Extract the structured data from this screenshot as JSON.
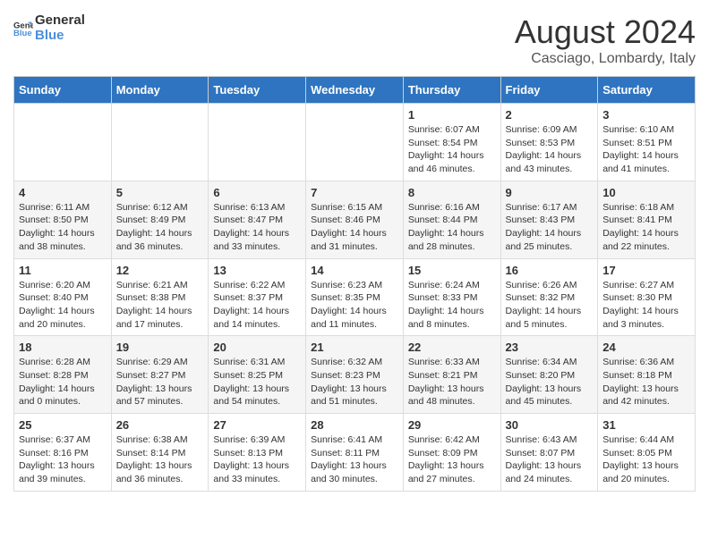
{
  "logo": {
    "line1": "General",
    "line2": "Blue"
  },
  "title": "August 2024",
  "subtitle": "Casciago, Lombardy, Italy",
  "days_of_week": [
    "Sunday",
    "Monday",
    "Tuesday",
    "Wednesday",
    "Thursday",
    "Friday",
    "Saturday"
  ],
  "weeks": [
    [
      {
        "day": "",
        "info": ""
      },
      {
        "day": "",
        "info": ""
      },
      {
        "day": "",
        "info": ""
      },
      {
        "day": "",
        "info": ""
      },
      {
        "day": "1",
        "info": "Sunrise: 6:07 AM\nSunset: 8:54 PM\nDaylight: 14 hours\nand 46 minutes."
      },
      {
        "day": "2",
        "info": "Sunrise: 6:09 AM\nSunset: 8:53 PM\nDaylight: 14 hours\nand 43 minutes."
      },
      {
        "day": "3",
        "info": "Sunrise: 6:10 AM\nSunset: 8:51 PM\nDaylight: 14 hours\nand 41 minutes."
      }
    ],
    [
      {
        "day": "4",
        "info": "Sunrise: 6:11 AM\nSunset: 8:50 PM\nDaylight: 14 hours\nand 38 minutes."
      },
      {
        "day": "5",
        "info": "Sunrise: 6:12 AM\nSunset: 8:49 PM\nDaylight: 14 hours\nand 36 minutes."
      },
      {
        "day": "6",
        "info": "Sunrise: 6:13 AM\nSunset: 8:47 PM\nDaylight: 14 hours\nand 33 minutes."
      },
      {
        "day": "7",
        "info": "Sunrise: 6:15 AM\nSunset: 8:46 PM\nDaylight: 14 hours\nand 31 minutes."
      },
      {
        "day": "8",
        "info": "Sunrise: 6:16 AM\nSunset: 8:44 PM\nDaylight: 14 hours\nand 28 minutes."
      },
      {
        "day": "9",
        "info": "Sunrise: 6:17 AM\nSunset: 8:43 PM\nDaylight: 14 hours\nand 25 minutes."
      },
      {
        "day": "10",
        "info": "Sunrise: 6:18 AM\nSunset: 8:41 PM\nDaylight: 14 hours\nand 22 minutes."
      }
    ],
    [
      {
        "day": "11",
        "info": "Sunrise: 6:20 AM\nSunset: 8:40 PM\nDaylight: 14 hours\nand 20 minutes."
      },
      {
        "day": "12",
        "info": "Sunrise: 6:21 AM\nSunset: 8:38 PM\nDaylight: 14 hours\nand 17 minutes."
      },
      {
        "day": "13",
        "info": "Sunrise: 6:22 AM\nSunset: 8:37 PM\nDaylight: 14 hours\nand 14 minutes."
      },
      {
        "day": "14",
        "info": "Sunrise: 6:23 AM\nSunset: 8:35 PM\nDaylight: 14 hours\nand 11 minutes."
      },
      {
        "day": "15",
        "info": "Sunrise: 6:24 AM\nSunset: 8:33 PM\nDaylight: 14 hours\nand 8 minutes."
      },
      {
        "day": "16",
        "info": "Sunrise: 6:26 AM\nSunset: 8:32 PM\nDaylight: 14 hours\nand 5 minutes."
      },
      {
        "day": "17",
        "info": "Sunrise: 6:27 AM\nSunset: 8:30 PM\nDaylight: 14 hours\nand 3 minutes."
      }
    ],
    [
      {
        "day": "18",
        "info": "Sunrise: 6:28 AM\nSunset: 8:28 PM\nDaylight: 14 hours\nand 0 minutes."
      },
      {
        "day": "19",
        "info": "Sunrise: 6:29 AM\nSunset: 8:27 PM\nDaylight: 13 hours\nand 57 minutes."
      },
      {
        "day": "20",
        "info": "Sunrise: 6:31 AM\nSunset: 8:25 PM\nDaylight: 13 hours\nand 54 minutes."
      },
      {
        "day": "21",
        "info": "Sunrise: 6:32 AM\nSunset: 8:23 PM\nDaylight: 13 hours\nand 51 minutes."
      },
      {
        "day": "22",
        "info": "Sunrise: 6:33 AM\nSunset: 8:21 PM\nDaylight: 13 hours\nand 48 minutes."
      },
      {
        "day": "23",
        "info": "Sunrise: 6:34 AM\nSunset: 8:20 PM\nDaylight: 13 hours\nand 45 minutes."
      },
      {
        "day": "24",
        "info": "Sunrise: 6:36 AM\nSunset: 8:18 PM\nDaylight: 13 hours\nand 42 minutes."
      }
    ],
    [
      {
        "day": "25",
        "info": "Sunrise: 6:37 AM\nSunset: 8:16 PM\nDaylight: 13 hours\nand 39 minutes."
      },
      {
        "day": "26",
        "info": "Sunrise: 6:38 AM\nSunset: 8:14 PM\nDaylight: 13 hours\nand 36 minutes."
      },
      {
        "day": "27",
        "info": "Sunrise: 6:39 AM\nSunset: 8:13 PM\nDaylight: 13 hours\nand 33 minutes."
      },
      {
        "day": "28",
        "info": "Sunrise: 6:41 AM\nSunset: 8:11 PM\nDaylight: 13 hours\nand 30 minutes."
      },
      {
        "day": "29",
        "info": "Sunrise: 6:42 AM\nSunset: 8:09 PM\nDaylight: 13 hours\nand 27 minutes."
      },
      {
        "day": "30",
        "info": "Sunrise: 6:43 AM\nSunset: 8:07 PM\nDaylight: 13 hours\nand 24 minutes."
      },
      {
        "day": "31",
        "info": "Sunrise: 6:44 AM\nSunset: 8:05 PM\nDaylight: 13 hours\nand 20 minutes."
      }
    ]
  ]
}
